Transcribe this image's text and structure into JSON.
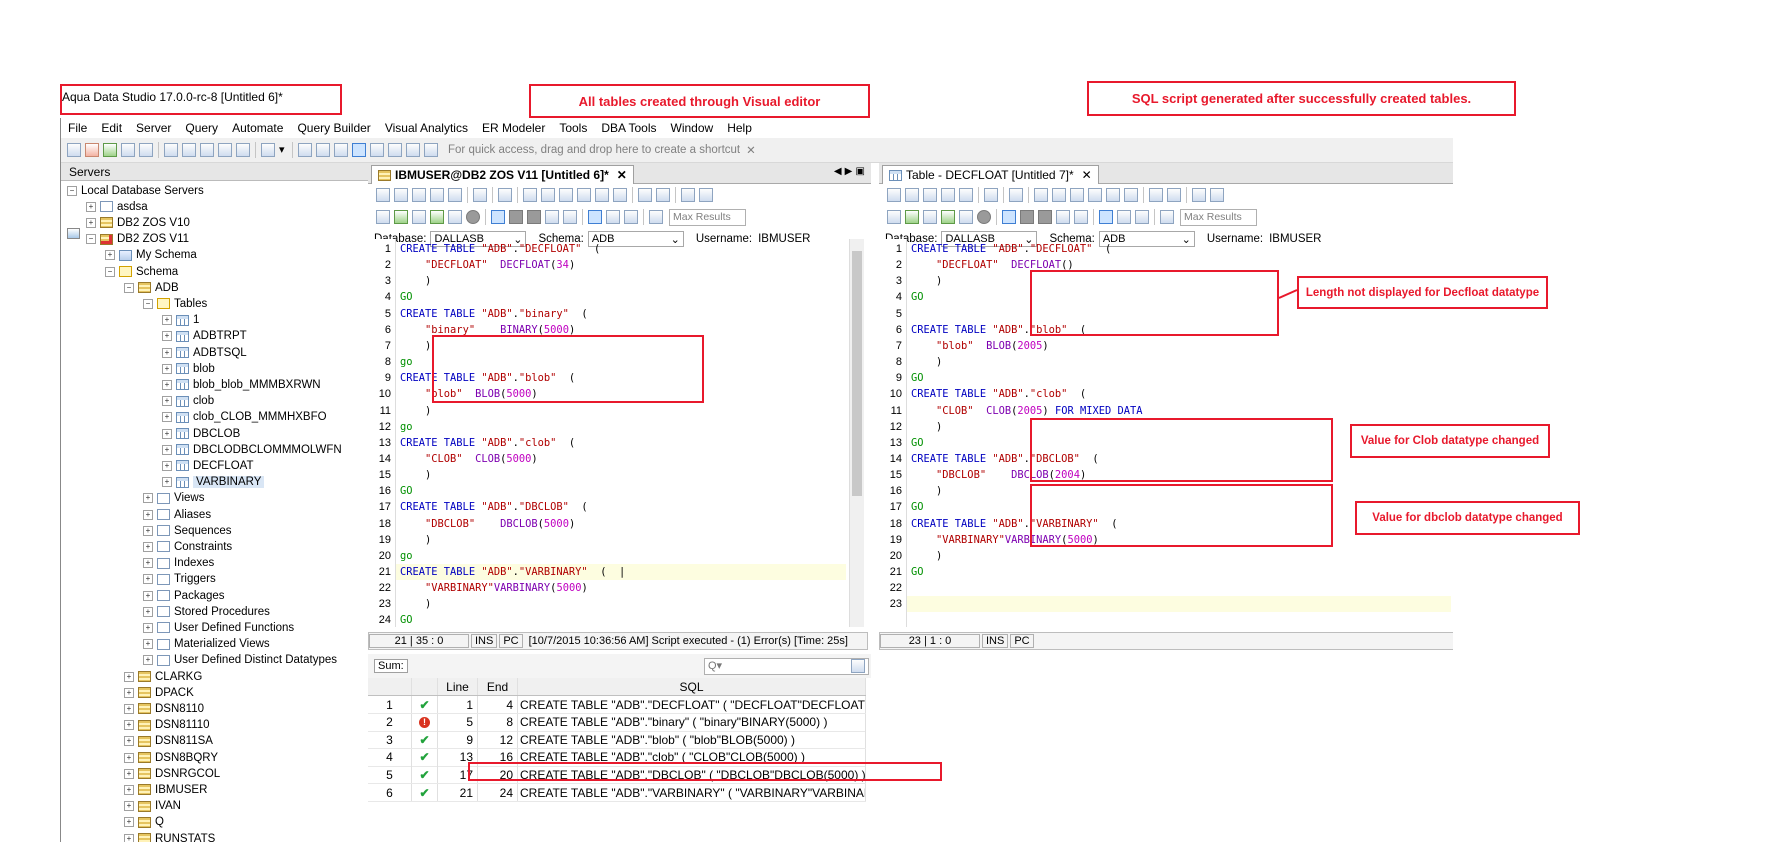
{
  "window": {
    "title": "Aqua Data Studio 17.0.0-rc-8 [Untitled 6]*"
  },
  "callouts": {
    "visual_editor": "All tables created through Visual editor",
    "sql_generated": "SQL script generated after successfully created tables.",
    "decfloat": "Length not displayed for Decfloat datatype",
    "clob": "Value for Clob datatype changed",
    "dbclob": "Value for dbclob datatype changed"
  },
  "menu": [
    "File",
    "Edit",
    "Server",
    "Query",
    "Automate",
    "Query Builder",
    "Visual Analytics",
    "ER Modeler",
    "Tools",
    "DBA Tools",
    "Window",
    "Help"
  ],
  "toolbar": {
    "shortcut_hint": "For quick access, drag and drop here to create a shortcut",
    "shortcut_close": "✕"
  },
  "servers_panel": {
    "title": "Servers",
    "tree": [
      {
        "label": "Local Database Servers",
        "exp": "−",
        "icon": "servers"
      },
      {
        "label": "asdsa",
        "exp": "+",
        "icon": "folder"
      },
      {
        "label": "DB2 ZOS V10",
        "exp": "+",
        "icon": "db"
      },
      {
        "label": "DB2 ZOS V11",
        "exp": "−",
        "icon": "db-active"
      },
      {
        "label": "My Schema",
        "exp": "+",
        "icon": "schema"
      },
      {
        "label": "Schema",
        "exp": "−",
        "icon": "folder-open"
      },
      {
        "label": "ADB",
        "exp": "−",
        "icon": "db"
      },
      {
        "label": "Tables",
        "exp": "−",
        "icon": "folder-open"
      },
      {
        "label": "1",
        "exp": "+",
        "icon": "table"
      },
      {
        "label": "ADBTRPT",
        "exp": "+",
        "icon": "table"
      },
      {
        "label": "ADBTSQL",
        "exp": "+",
        "icon": "table"
      },
      {
        "label": "blob",
        "exp": "+",
        "icon": "table"
      },
      {
        "label": "blob_blob_MMMBXRWN",
        "exp": "+",
        "icon": "table"
      },
      {
        "label": "clob",
        "exp": "+",
        "icon": "table"
      },
      {
        "label": "clob_CLOB_MMMHXBFO",
        "exp": "+",
        "icon": "table"
      },
      {
        "label": "DBCLOB",
        "exp": "+",
        "icon": "table"
      },
      {
        "label": "DBCLODBCLOMMMOLWFN",
        "exp": "+",
        "icon": "table"
      },
      {
        "label": "DECFLOAT",
        "exp": "+",
        "icon": "table"
      },
      {
        "label": "VARBINARY",
        "exp": "+",
        "icon": "table",
        "selected": true
      },
      {
        "label": "Views",
        "exp": "+",
        "icon": "folder"
      },
      {
        "label": "Aliases",
        "exp": "+",
        "icon": "folder"
      },
      {
        "label": "Sequences",
        "exp": "+",
        "icon": "folder"
      },
      {
        "label": "Constraints",
        "exp": "+",
        "icon": "folder"
      },
      {
        "label": "Indexes",
        "exp": "+",
        "icon": "folder"
      },
      {
        "label": "Triggers",
        "exp": "+",
        "icon": "folder"
      },
      {
        "label": "Packages",
        "exp": "+",
        "icon": "folder"
      },
      {
        "label": "Stored Procedures",
        "exp": "+",
        "icon": "folder"
      },
      {
        "label": "User Defined Functions",
        "exp": "+",
        "icon": "folder"
      },
      {
        "label": "Materialized Views",
        "exp": "+",
        "icon": "folder"
      },
      {
        "label": "User Defined Distinct Datatypes",
        "exp": "+",
        "icon": "folder"
      },
      {
        "label": "CLARKG",
        "exp": "+",
        "icon": "db"
      },
      {
        "label": "DPACK",
        "exp": "+",
        "icon": "db"
      },
      {
        "label": "DSN8110",
        "exp": "+",
        "icon": "db"
      },
      {
        "label": "DSN81110",
        "exp": "+",
        "icon": "db"
      },
      {
        "label": "DSN811SA",
        "exp": "+",
        "icon": "db"
      },
      {
        "label": "DSN8BQRY",
        "exp": "+",
        "icon": "db"
      },
      {
        "label": "DSNRGCOL",
        "exp": "+",
        "icon": "db"
      },
      {
        "label": "IBMUSER",
        "exp": "+",
        "icon": "db"
      },
      {
        "label": "IVAN",
        "exp": "+",
        "icon": "db"
      },
      {
        "label": "Q",
        "exp": "+",
        "icon": "db"
      },
      {
        "label": "RUNSTATS",
        "exp": "+",
        "icon": "db"
      }
    ]
  },
  "left_editor": {
    "tab": "IBMUSER@DB2 ZOS V11 [Untitled 6]*",
    "tab_close": "✕",
    "nav": "◀ ▶ ▣",
    "max_results": "Max Results",
    "db_label": "Database:",
    "db_value": "DALLASB",
    "schema_label": "Schema:",
    "schema_value": "ADB",
    "user_label": "Username:",
    "user_value": "IBMUSER",
    "lines": [
      [
        [
          "kw",
          "CREATE TABLE "
        ],
        [
          "str",
          "\"ADB\""
        ],
        [
          "",
          "."
        ],
        [
          "str",
          "\"DECFLOAT\""
        ],
        [
          "",
          "  ("
        ]
      ],
      [
        [
          "",
          "    "
        ],
        [
          "str",
          "\"DECFLOAT\""
        ],
        [
          "",
          "  "
        ],
        [
          "fn",
          "DECFLOAT"
        ],
        [
          "",
          "("
        ],
        [
          "num",
          "34"
        ],
        [
          "",
          ")"
        ]
      ],
      [
        [
          "",
          "    )"
        ]
      ],
      [
        [
          "go",
          "GO"
        ]
      ],
      [
        [
          "kw",
          "CREATE TABLE "
        ],
        [
          "str",
          "\"ADB\""
        ],
        [
          "",
          "."
        ],
        [
          "str",
          "\"binary\""
        ],
        [
          "",
          "  ("
        ]
      ],
      [
        [
          "",
          "    "
        ],
        [
          "str",
          "\"binary\""
        ],
        [
          "",
          "    "
        ],
        [
          "fn",
          "BINARY"
        ],
        [
          "",
          "("
        ],
        [
          "num",
          "5000"
        ],
        [
          "",
          ")"
        ]
      ],
      [
        [
          "",
          "    )"
        ]
      ],
      [
        [
          "go",
          "go"
        ]
      ],
      [
        [
          "kw",
          "CREATE TABLE "
        ],
        [
          "str",
          "\"ADB\""
        ],
        [
          "",
          "."
        ],
        [
          "str",
          "\"blob\""
        ],
        [
          "",
          "  ("
        ]
      ],
      [
        [
          "",
          "    "
        ],
        [
          "str",
          "\"blob\""
        ],
        [
          "",
          "  "
        ],
        [
          "fn",
          "BLOB"
        ],
        [
          "",
          "("
        ],
        [
          "num",
          "5000"
        ],
        [
          "",
          ")"
        ]
      ],
      [
        [
          "",
          "    )"
        ]
      ],
      [
        [
          "go",
          "go"
        ]
      ],
      [
        [
          "kw",
          "CREATE TABLE "
        ],
        [
          "str",
          "\"ADB\""
        ],
        [
          "",
          "."
        ],
        [
          "str",
          "\"clob\""
        ],
        [
          "",
          "  ("
        ]
      ],
      [
        [
          "",
          "    "
        ],
        [
          "str",
          "\"CLOB\""
        ],
        [
          "",
          "  "
        ],
        [
          "fn",
          "CLOB"
        ],
        [
          "",
          "("
        ],
        [
          "num",
          "5000"
        ],
        [
          "",
          ")"
        ]
      ],
      [
        [
          "",
          "    )"
        ]
      ],
      [
        [
          "go",
          "GO"
        ]
      ],
      [
        [
          "kw",
          "CREATE TABLE "
        ],
        [
          "str",
          "\"ADB\""
        ],
        [
          "",
          "."
        ],
        [
          "str",
          "\"DBCLOB\""
        ],
        [
          "",
          "  ("
        ]
      ],
      [
        [
          "",
          "    "
        ],
        [
          "str",
          "\"DBCLOB\""
        ],
        [
          "",
          "    "
        ],
        [
          "fn",
          "DBCLOB"
        ],
        [
          "",
          "("
        ],
        [
          "num",
          "5000"
        ],
        [
          "",
          ")"
        ]
      ],
      [
        [
          "",
          "    )"
        ]
      ],
      [
        [
          "go",
          "go"
        ]
      ],
      [
        [
          "kw",
          "CREATE TABLE "
        ],
        [
          "str",
          "\"ADB\""
        ],
        [
          "",
          "."
        ],
        [
          "str",
          "\"VARBINARY\""
        ],
        [
          "",
          "  (  |"
        ]
      ],
      [
        [
          "",
          "    "
        ],
        [
          "str",
          "\"VARBINARY\""
        ],
        [
          "",
          ""
        ],
        [
          "fn",
          "VARBINARY"
        ],
        [
          "",
          "("
        ],
        [
          "num",
          "5000"
        ],
        [
          "",
          ")"
        ]
      ],
      [
        [
          "",
          "    )"
        ]
      ],
      [
        [
          "go",
          "GO"
        ]
      ]
    ],
    "status": {
      "pos": "21 | 35 : 0",
      "ins": "INS",
      "pc": "PC",
      "msg": "[10/7/2015 10:36:56 AM] Script executed - (1) Error(s) [Time: 25s]"
    },
    "results": {
      "sum_label": "Sum:",
      "search_icon_text": "Q▾",
      "headers": [
        "",
        "",
        "Line",
        "End",
        "SQL"
      ],
      "rows": [
        {
          "n": "1",
          "status": "ok",
          "line": "1",
          "end": "4",
          "sql": "CREATE TABLE \"ADB\".\"DECFLOAT\"  (  \"DECFLOAT\"DECFLOAT(34)  )"
        },
        {
          "n": "2",
          "status": "error",
          "line": "5",
          "end": "8",
          "sql": "CREATE TABLE \"ADB\".\"binary\"  (  \"binary\"BINARY(5000)  )"
        },
        {
          "n": "3",
          "status": "ok",
          "line": "9",
          "end": "12",
          "sql": "CREATE TABLE \"ADB\".\"blob\"  (  \"blob\"BLOB(5000)  )"
        },
        {
          "n": "4",
          "status": "ok",
          "line": "13",
          "end": "16",
          "sql": "CREATE TABLE \"ADB\".\"clob\"  (  \"CLOB\"CLOB(5000)  )"
        },
        {
          "n": "5",
          "status": "ok",
          "line": "17",
          "end": "20",
          "sql": "CREATE TABLE \"ADB\".\"DBCLOB\"  (  \"DBCLOB\"DBCLOB(5000)  )"
        },
        {
          "n": "6",
          "status": "ok",
          "line": "21",
          "end": "24",
          "sql": "CREATE TABLE \"ADB\".\"VARBINARY\"  (  \"VARBINARY\"VARBINARY(5000)  )"
        }
      ]
    }
  },
  "right_editor": {
    "tab": "Table - DECFLOAT [Untitled 7]*",
    "tab_close": "✕",
    "max_results": "Max Results",
    "db_label": "Database:",
    "db_value": "DALLASB",
    "schema_label": "Schema:",
    "schema_value": "ADB",
    "user_label": "Username:",
    "user_value": "IBMUSER",
    "lines": [
      [
        [
          "kw",
          "CREATE TABLE "
        ],
        [
          "str",
          "\"ADB\""
        ],
        [
          "",
          "."
        ],
        [
          "str",
          "\"DECFLOAT\""
        ],
        [
          "",
          "  ("
        ]
      ],
      [
        [
          "",
          "    "
        ],
        [
          "str",
          "\"DECFLOAT\""
        ],
        [
          "",
          "  "
        ],
        [
          "fn",
          "DECFLOAT"
        ],
        [
          "",
          "()"
        ]
      ],
      [
        [
          "",
          "    )"
        ]
      ],
      [
        [
          "go",
          "GO"
        ]
      ],
      [
        [
          "",
          ""
        ]
      ],
      [
        [
          "kw",
          "CREATE TABLE "
        ],
        [
          "str",
          "\"ADB\""
        ],
        [
          "",
          "."
        ],
        [
          "str",
          "\"blob\""
        ],
        [
          "",
          "  ("
        ]
      ],
      [
        [
          "",
          "    "
        ],
        [
          "str",
          "\"blob\""
        ],
        [
          "",
          "  "
        ],
        [
          "fn",
          "BLOB"
        ],
        [
          "",
          "("
        ],
        [
          "num",
          "2005"
        ],
        [
          "",
          ")"
        ]
      ],
      [
        [
          "",
          "    )"
        ]
      ],
      [
        [
          "go",
          "GO"
        ]
      ],
      [
        [
          "kw",
          "CREATE TABLE "
        ],
        [
          "str",
          "\"ADB\""
        ],
        [
          "",
          "."
        ],
        [
          "str",
          "\"clob\""
        ],
        [
          "",
          "  ("
        ]
      ],
      [
        [
          "",
          "    "
        ],
        [
          "str",
          "\"CLOB\""
        ],
        [
          "",
          "  "
        ],
        [
          "fn",
          "CLOB"
        ],
        [
          "",
          "("
        ],
        [
          "num",
          "2005"
        ],
        [
          "",
          ") "
        ],
        [
          "kw",
          "FOR MIXED DATA"
        ]
      ],
      [
        [
          "",
          "    )"
        ]
      ],
      [
        [
          "go",
          "GO"
        ]
      ],
      [
        [
          "kw",
          "CREATE TABLE "
        ],
        [
          "str",
          "\"ADB\""
        ],
        [
          "",
          "."
        ],
        [
          "str",
          "\"DBCLOB\""
        ],
        [
          "",
          "  ("
        ]
      ],
      [
        [
          "",
          "    "
        ],
        [
          "str",
          "\"DBCLOB\""
        ],
        [
          "",
          "    "
        ],
        [
          "fn",
          "DBCLOB"
        ],
        [
          "",
          "("
        ],
        [
          "num",
          "2004"
        ],
        [
          "",
          ")"
        ]
      ],
      [
        [
          "",
          "    )"
        ]
      ],
      [
        [
          "go",
          "GO"
        ]
      ],
      [
        [
          "kw",
          "CREATE TABLE "
        ],
        [
          "str",
          "\"ADB\""
        ],
        [
          "",
          "."
        ],
        [
          "str",
          "\"VARBINARY\""
        ],
        [
          "",
          "  ("
        ]
      ],
      [
        [
          "",
          "    "
        ],
        [
          "str",
          "\"VARBINARY\""
        ],
        [
          "",
          ""
        ],
        [
          "fn",
          "VARBINARY"
        ],
        [
          "",
          "("
        ],
        [
          "num",
          "5000"
        ],
        [
          "",
          ")"
        ]
      ],
      [
        [
          "",
          "    )"
        ]
      ],
      [
        [
          "go",
          "GO"
        ]
      ],
      [
        [
          "",
          ""
        ]
      ],
      [
        [
          "",
          ""
        ]
      ]
    ],
    "status": {
      "pos": "23 | 1 : 0",
      "ins": "INS",
      "pc": "PC"
    }
  }
}
